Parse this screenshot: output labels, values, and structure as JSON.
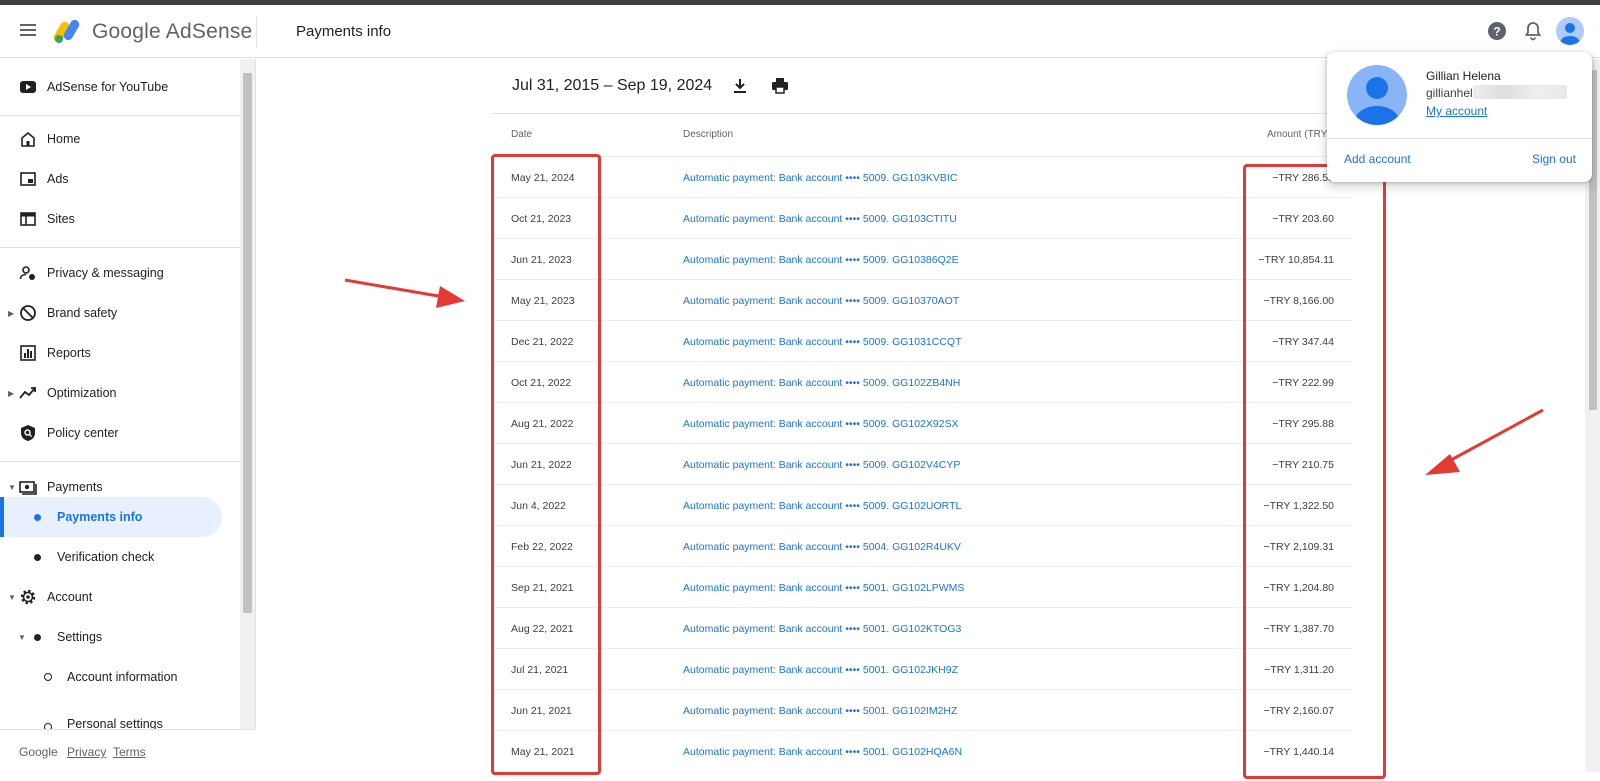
{
  "header": {
    "logo_text": "Google AdSense",
    "page_title": "Payments info"
  },
  "sidebar": {
    "top_item": "AdSense for YouTube",
    "items": [
      {
        "label": "Home"
      },
      {
        "label": "Ads"
      },
      {
        "label": "Sites"
      },
      {
        "label": "Privacy & messaging"
      },
      {
        "label": "Brand safety"
      },
      {
        "label": "Reports"
      },
      {
        "label": "Optimization"
      },
      {
        "label": "Policy center"
      },
      {
        "label": "Payments"
      },
      {
        "label": "Payments info"
      },
      {
        "label": "Verification check"
      },
      {
        "label": "Account"
      },
      {
        "label": "Settings"
      },
      {
        "label": "Account information"
      },
      {
        "label": "Personal settings"
      }
    ],
    "footer": {
      "brand": "Google",
      "privacy": "Privacy",
      "terms": "Terms"
    }
  },
  "main": {
    "date_range": "Jul 31, 2015 – Sep 19, 2024",
    "columns": {
      "date": "Date",
      "description": "Description",
      "amount": "Amount (TRY)"
    },
    "rows": [
      {
        "date": "May 21, 2024",
        "description": "Automatic payment: Bank account •••• 5009. GG103KVBIC",
        "amount": "−TRY 286.53"
      },
      {
        "date": "Oct 21, 2023",
        "description": "Automatic payment: Bank account •••• 5009. GG103CTITU",
        "amount": "−TRY 203.60"
      },
      {
        "date": "Jun 21, 2023",
        "description": "Automatic payment: Bank account •••• 5009. GG10386Q2E",
        "amount": "−TRY 10,854.11"
      },
      {
        "date": "May 21, 2023",
        "description": "Automatic payment: Bank account •••• 5009. GG10370AOT",
        "amount": "−TRY 8,166.00"
      },
      {
        "date": "Dec 21, 2022",
        "description": "Automatic payment: Bank account •••• 5009. GG1031CCQT",
        "amount": "−TRY 347.44"
      },
      {
        "date": "Oct 21, 2022",
        "description": "Automatic payment: Bank account •••• 5009. GG102ZB4NH",
        "amount": "−TRY 222.99"
      },
      {
        "date": "Aug 21, 2022",
        "description": "Automatic payment: Bank account •••• 5009. GG102X92SX",
        "amount": "−TRY 295.88"
      },
      {
        "date": "Jun 21, 2022",
        "description": "Automatic payment: Bank account •••• 5009. GG102V4CYP",
        "amount": "−TRY 210.75"
      },
      {
        "date": "Jun 4, 2022",
        "description": "Automatic payment: Bank account •••• 5009. GG102UORTL",
        "amount": "−TRY 1,322.50"
      },
      {
        "date": "Feb 22, 2022",
        "description": "Automatic payment: Bank account •••• 5004. GG102R4UKV",
        "amount": "−TRY 2,109.31"
      },
      {
        "date": "Sep 21, 2021",
        "description": "Automatic payment: Bank account •••• 5001. GG102LPWMS",
        "amount": "−TRY 1,204.80"
      },
      {
        "date": "Aug 22, 2021",
        "description": "Automatic payment: Bank account •••• 5001. GG102KTOG3",
        "amount": "−TRY 1,387.70"
      },
      {
        "date": "Jul 21, 2021",
        "description": "Automatic payment: Bank account •••• 5001. GG102JKH9Z",
        "amount": "−TRY 1,311.20"
      },
      {
        "date": "Jun 21, 2021",
        "description": "Automatic payment: Bank account •••• 5001. GG102IM2HZ",
        "amount": "−TRY 2,160.07"
      },
      {
        "date": "May 21, 2021",
        "description": "Automatic payment: Bank account •••• 5001. GG102HQA6N",
        "amount": "−TRY 1,440.14"
      }
    ]
  },
  "account_popup": {
    "name": "Gillian Helena",
    "email_visible": "gillianhele",
    "my_account": "My account",
    "add_account": "Add account",
    "sign_out": "Sign out"
  },
  "colors": {
    "accent": "#1a73e8",
    "highlight": "#e53935",
    "active_bg": "#e8f0fe"
  },
  "icons": [
    "menu-icon",
    "adsense-logo-icon",
    "help-icon",
    "bell-icon",
    "avatar-icon",
    "download-icon",
    "print-icon",
    "youtube-icon",
    "home-icon",
    "ads-icon",
    "sites-icon",
    "privacy-icon",
    "brand-safety-icon",
    "reports-icon",
    "optimization-icon",
    "policy-icon",
    "payments-icon",
    "gear-icon"
  ]
}
